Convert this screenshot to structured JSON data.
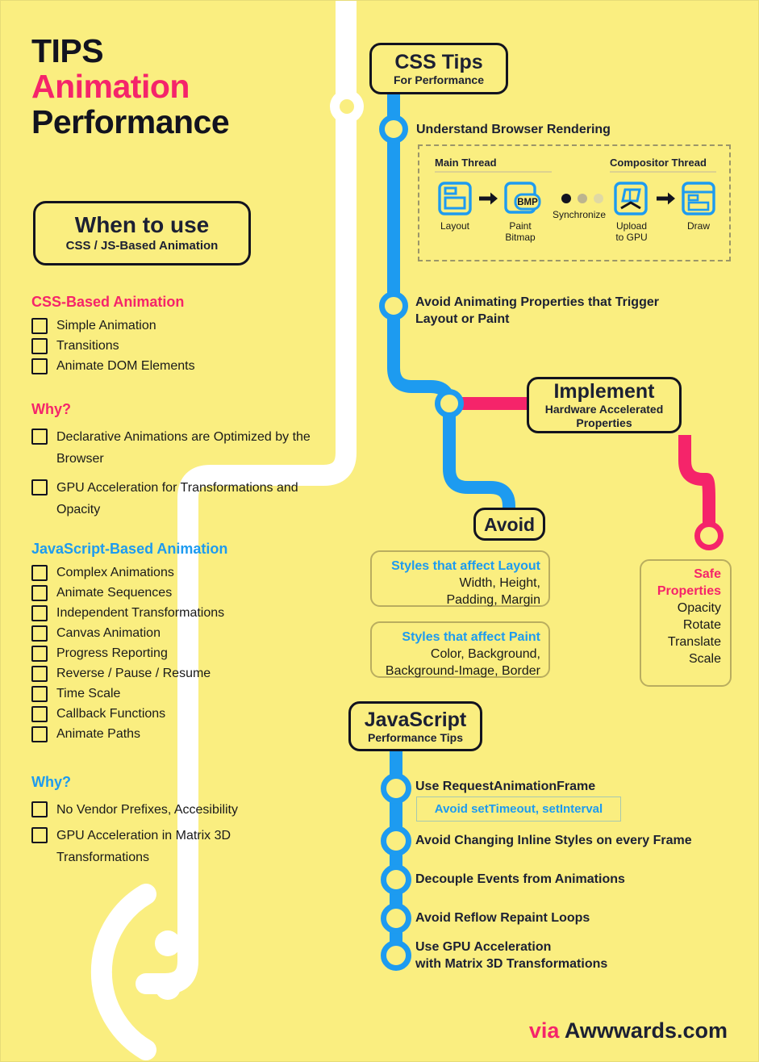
{
  "colors": {
    "background": "#faee80",
    "ink": "#1c2033",
    "pink": "#f5246a",
    "blue": "#1d9bf0",
    "white": "#ffffff"
  },
  "headline": {
    "line1": "TIPS",
    "line2": "Animation",
    "line3": "Performance"
  },
  "when_to_use": {
    "title": "When to use",
    "subtitle": "CSS / JS-Based Animation"
  },
  "css_based": {
    "heading": "CSS-Based Animation",
    "items": [
      "Simple Animation",
      "Transitions",
      "Animate DOM Elements"
    ],
    "why_heading": "Why?",
    "why_items": [
      "Declarative Animations are Optimized by the Browser",
      "GPU Acceleration for Transformations and Opacity"
    ]
  },
  "js_based": {
    "heading": "JavaScript-Based Animation",
    "items": [
      "Complex Animations",
      "Animate Sequences",
      "Independent Transformations",
      "Canvas Animation",
      "Progress Reporting",
      "Reverse / Pause / Resume",
      "Time Scale",
      "Callback Functions",
      "Animate Paths"
    ],
    "why_heading": "Why?",
    "why_items": [
      "No Vendor Prefixes, Accesibility",
      "GPU Acceleration in Matrix 3D Transformations"
    ]
  },
  "css_tips": {
    "title": "CSS Tips",
    "subtitle": "For Performance",
    "node1_label": "Understand Browser Rendering",
    "node2_label": "Avoid Animating Properties that Trigger Layout or Paint"
  },
  "render_panel": {
    "main_thread": "Main Thread",
    "compositor_thread": "Compositor Thread",
    "synchronize": "Synchronize",
    "bmp": "BMP",
    "steps": [
      {
        "icon": "layout-icon",
        "caption": "Layout"
      },
      {
        "icon": "paint-bitmap-icon",
        "caption": "Paint\nBitmap"
      },
      {
        "icon": "upload-gpu-icon",
        "caption": "Upload\nto GPU"
      },
      {
        "icon": "draw-icon",
        "caption": "Draw"
      }
    ]
  },
  "implement": {
    "title": "Implement",
    "subtitle_line1": "Hardware Accelerated",
    "subtitle_line2": "Properties"
  },
  "avoid": {
    "title": "Avoid",
    "boxes": [
      {
        "heading": "Styles that affect Layout",
        "line1": "Width, Height,",
        "line2": "Padding, Margin"
      },
      {
        "heading": "Styles that affect Paint",
        "line1": "Color, Background,",
        "line2": "Background-Image, Border"
      }
    ]
  },
  "safe_properties": {
    "heading_line1": "Safe",
    "heading_line2": "Properties",
    "items": [
      "Opacity",
      "Rotate",
      "Translate",
      "Scale"
    ]
  },
  "javascript_tips": {
    "title": "JavaScript",
    "subtitle": "Performance Tips",
    "subnote": "Avoid setTimeout, setInterval",
    "nodes": [
      "Use RequestAnimationFrame",
      "Avoid Changing Inline Styles on every Frame",
      "Decouple Events from Animations",
      "Avoid Reflow Repaint Loops",
      "Use GPU Acceleration\nwith Matrix 3D Transformations"
    ]
  },
  "footer": {
    "via": "via",
    "brand": "Awwwards.com"
  }
}
